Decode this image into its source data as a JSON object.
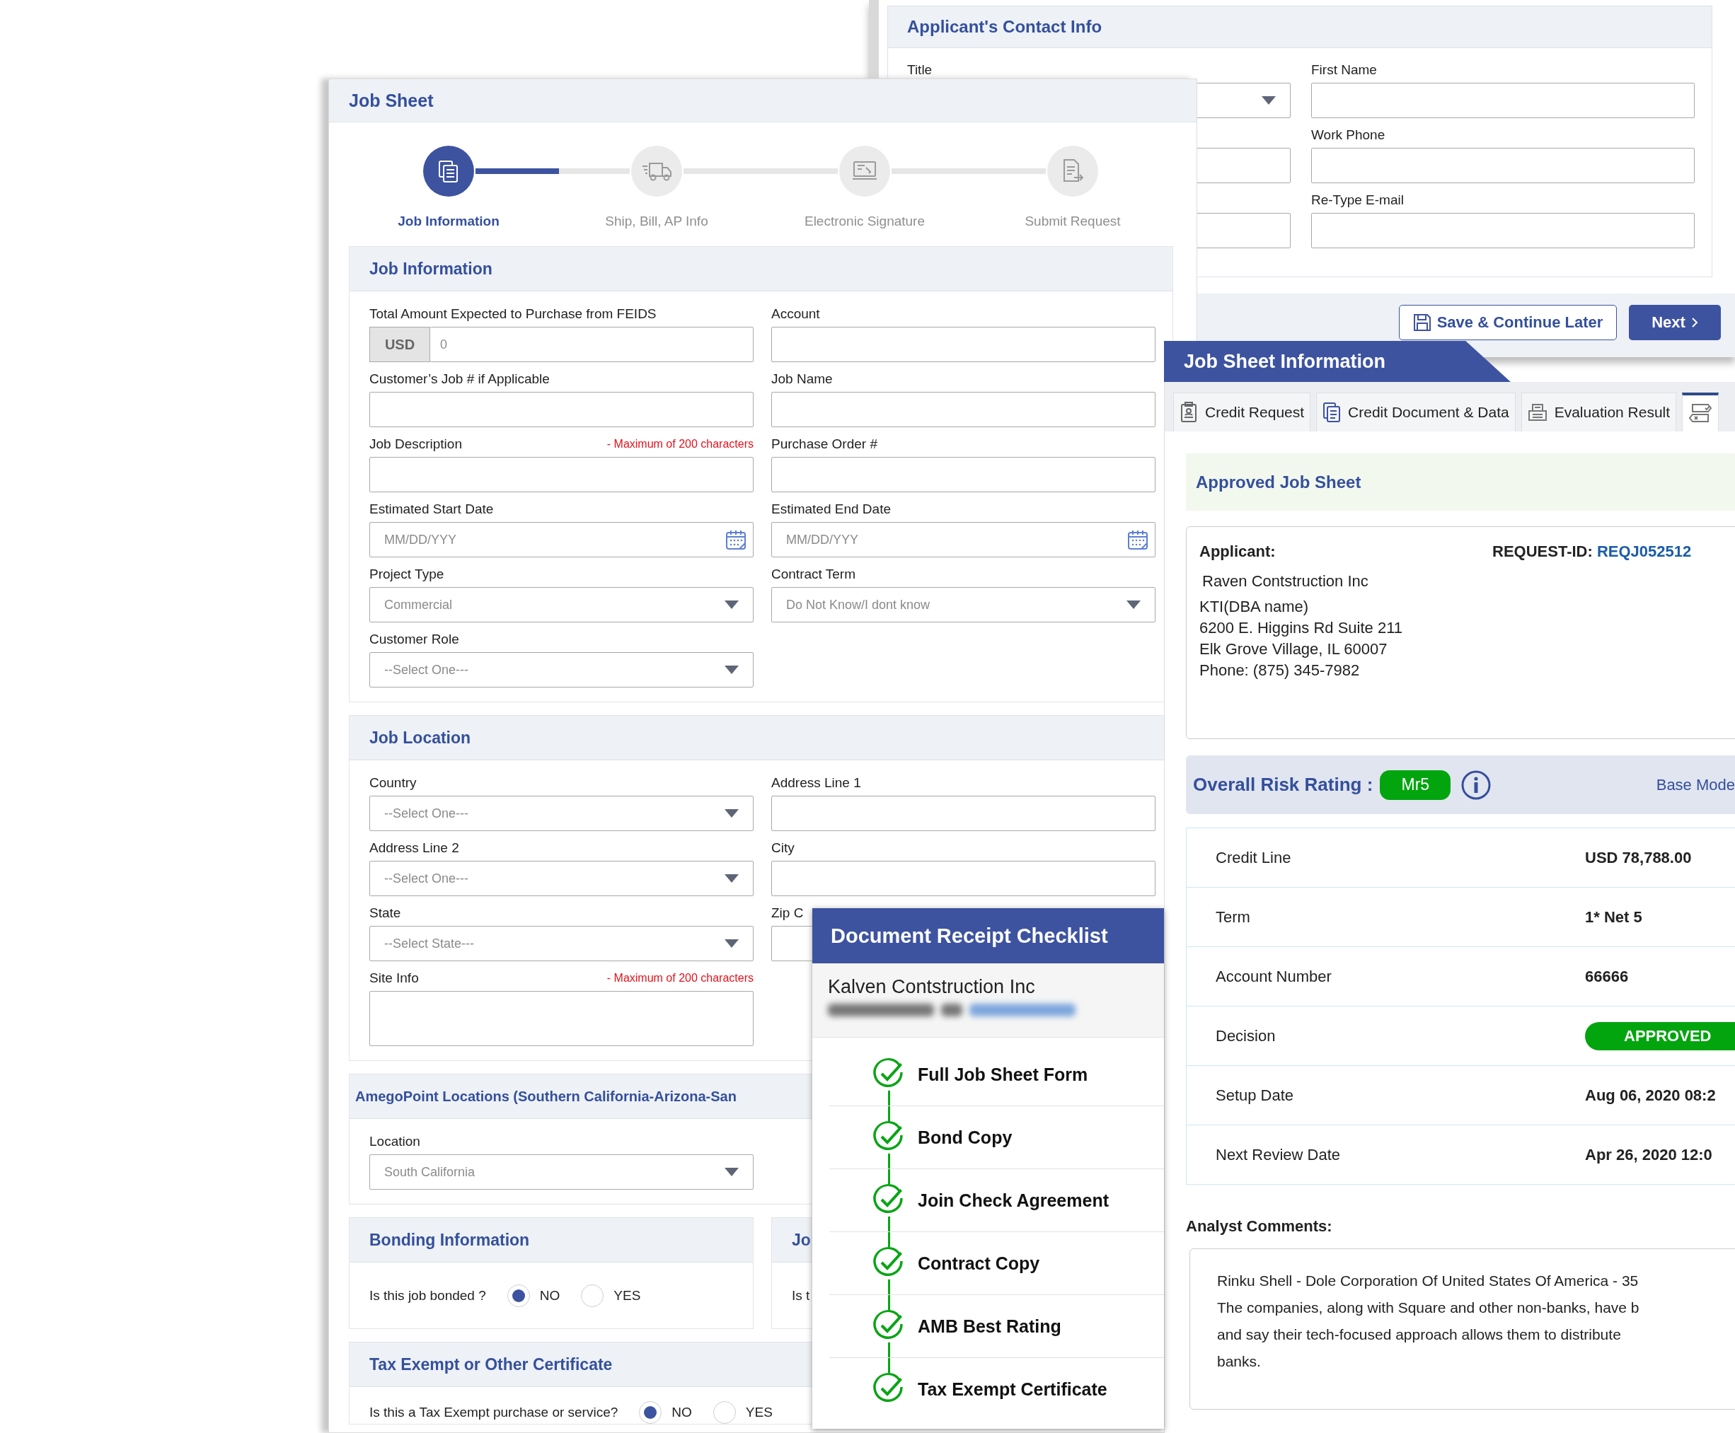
{
  "contact_window": {
    "title": "Applicant's Contact Info",
    "fields": [
      {
        "label": "Title",
        "kind": "select"
      },
      {
        "label": "First Name",
        "kind": "text"
      },
      {
        "kind": "text"
      },
      {
        "label": "Work Phone",
        "kind": "text"
      },
      {
        "kind": "text"
      },
      {
        "label": "Re-Type E-mail",
        "kind": "text"
      }
    ],
    "buttons": [
      {
        "label": "Save & Continue Later",
        "kind": "secondary"
      },
      {
        "label": "Next",
        "kind": "primary"
      }
    ]
  },
  "job_sheet": {
    "title": "Job Sheet",
    "stepper": {
      "steps": [
        {
          "label": "Job Information",
          "selected": true,
          "level": 0.54
        },
        {
          "label": "Ship, Bill, AP Info",
          "selected": false
        },
        {
          "label": "Electronic Signature",
          "selected": false
        },
        {
          "label": "Submit Request",
          "selected": false
        }
      ]
    },
    "sections": [
      {
        "kind": "form",
        "title": "Job Information",
        "fields": [
          {
            "label": "Total Amount Expected to Purchase from FEIDS",
            "kind": "currency",
            "prefix": "USD",
            "placeholder": "0"
          },
          {
            "label": "Account",
            "kind": "text"
          },
          {
            "label": "Customer’s Job # if Applicable",
            "kind": "text"
          },
          {
            "label": "Job Name",
            "kind": "text"
          },
          {
            "label": "Job Description",
            "note": "- Maximum of 200 characters",
            "kind": "text"
          },
          {
            "label": "Purchase Order #",
            "kind": "text"
          },
          {
            "label": "Estimated Start Date",
            "kind": "date",
            "placeholder": "MM/DD/YYY"
          },
          {
            "label": "Estimated End Date",
            "kind": "date",
            "placeholder": "MM/DD/YYY"
          },
          {
            "label": "Project Type",
            "kind": "select",
            "value": "Commercial"
          },
          {
            "label": "Contract Term",
            "kind": "select",
            "value": "Do Not Know/I dont know"
          },
          {
            "label": "Customer Role",
            "kind": "select",
            "value": "--Select One---"
          }
        ]
      },
      {
        "kind": "form",
        "title": "Job Location",
        "fields": [
          {
            "label": "Country",
            "kind": "select",
            "value": "--Select One---"
          },
          {
            "label": "Address Line 1",
            "kind": "text"
          },
          {
            "label": "Address Line 2",
            "kind": "select",
            "value": "--Select One---"
          },
          {
            "label": "City",
            "kind": "text"
          },
          {
            "label": "State",
            "kind": "select",
            "value": "--Select State---"
          },
          {
            "label": "Zip C",
            "kind": "text"
          },
          {
            "label": "Site Info",
            "note": "- Maximum of 200 characters",
            "kind": "textarea"
          }
        ]
      },
      {
        "kind": "form",
        "title": "AmegoPoint Locations (Southern California-Arizona-San",
        "fields": [
          {
            "label": "Location",
            "kind": "select",
            "value": "South California"
          }
        ]
      },
      {
        "kind": "pair",
        "sections": [
          {
            "kind": "radio",
            "title": "Bonding Information",
            "question": "Is this job bonded ?",
            "options": [
              {
                "label": "NO",
                "selected": true
              },
              {
                "label": "YES",
                "selected": false
              }
            ]
          },
          {
            "kind": "radio",
            "title": "Jo",
            "question": "Is t"
          }
        ]
      },
      {
        "kind": "radio",
        "title": "Tax Exempt or Other Certificate",
        "question": "Is this a Tax Exempt purchase or service?",
        "options": [
          {
            "label": "NO",
            "selected": true
          },
          {
            "label": "YES",
            "selected": false
          }
        ]
      }
    ]
  },
  "job_sheet_info": {
    "title": "Job Sheet Information",
    "tabs": [
      {
        "label": "Credit Request",
        "selected": false
      },
      {
        "label": "Credit Document & Data",
        "selected": false
      },
      {
        "label": "Evaluation Result",
        "selected": false
      },
      {
        "selected": true
      }
    ],
    "banner": "Approved Job Sheet",
    "applicant": {
      "label": "Applicant:",
      "request_label": "REQUEST-ID:",
      "request_id": "REQJ052512",
      "lines": [
        "Raven Contstruction Inc",
        "KTI(DBA name)",
        "6200 E. Higgins Rd Suite 211",
        "Elk Grove Village, IL 60007",
        "Phone: (875) 345-7982"
      ]
    },
    "risk": {
      "label": "Overall Risk Rating :",
      "rating": "Mr5",
      "link": "Base Mode"
    },
    "details": [
      {
        "label": "Credit Line",
        "kind": "text",
        "value": "USD 78,788.00"
      },
      {
        "label": "Term",
        "kind": "text",
        "value": "1*  Net 5"
      },
      {
        "label": "Account Number",
        "kind": "text",
        "value": "66666"
      },
      {
        "label": "Decision",
        "kind": "badge",
        "value": "APPROVED"
      },
      {
        "label": "Setup Date",
        "kind": "text",
        "value": "Aug 06, 2020 08:2"
      },
      {
        "label": "Next Review Date",
        "kind": "text",
        "value": "Apr 26, 2020 12:0"
      }
    ],
    "comments_label": "Analyst Comments:",
    "comments": [
      "Rinku Shell - Dole Corporation Of United States Of America - 35",
      "The companies, along with Square and other non-banks, have b",
      "and say their tech-focused approach allows them to distribute",
      "banks."
    ]
  },
  "checklist": {
    "title": "Document Receipt Checklist",
    "company": "Kalven Contstruction Inc",
    "items": [
      {
        "label": "Full Job Sheet Form",
        "checked": true
      },
      {
        "label": "Bond Copy",
        "checked": true
      },
      {
        "label": "Join Check Agreement",
        "checked": true
      },
      {
        "label": "Contract Copy",
        "checked": true
      },
      {
        "label": "AMB Best Rating",
        "checked": true
      },
      {
        "label": "Tax Exempt Certificate",
        "checked": true
      }
    ]
  }
}
